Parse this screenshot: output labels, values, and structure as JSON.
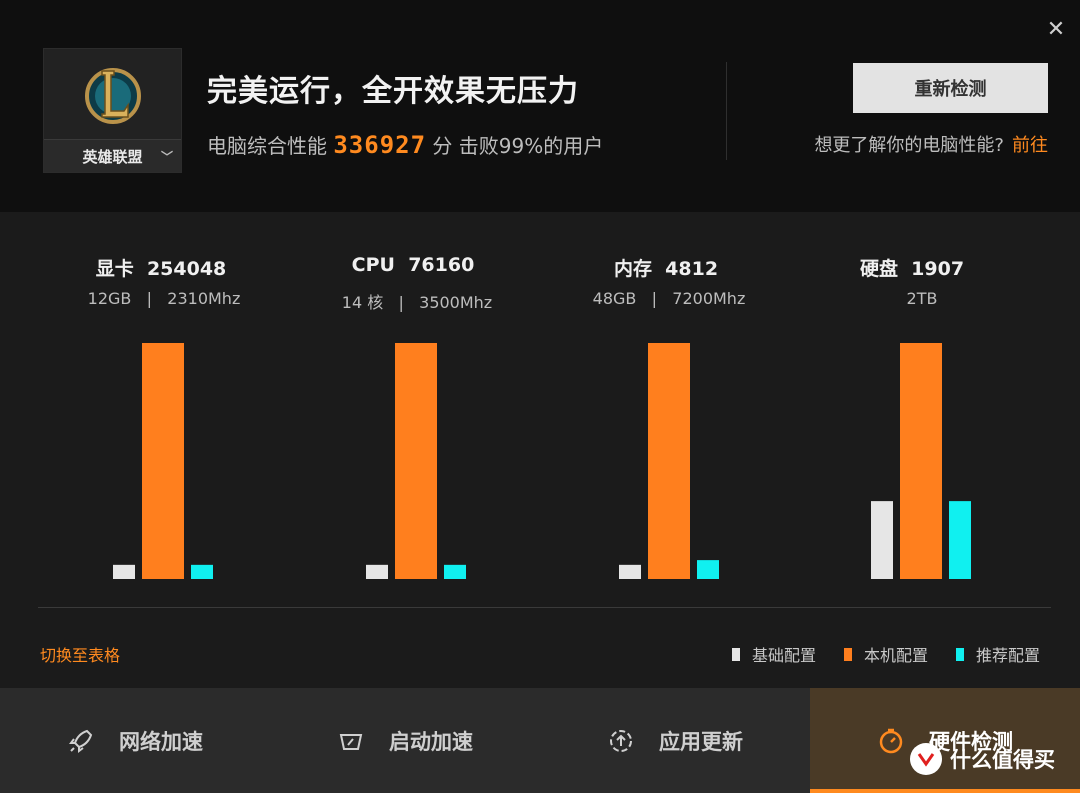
{
  "window": {
    "close_glyph": "✕"
  },
  "game": {
    "name": "英雄联盟",
    "logo_letter": "L"
  },
  "header": {
    "headline": "完美运行，全开效果无压力",
    "score_prefix": "电脑综合性能",
    "score_value": "336927",
    "score_suffix": "分 击败99%的用户",
    "recheck_label": "重新检测",
    "learn_text": "想更了解你的电脑性能?",
    "learn_link": "前往"
  },
  "colors": {
    "accent": "#ff8a1f",
    "baseline_bar": "#e6e6e6",
    "machine_bar": "#ff7f1e",
    "recommend_bar": "#10f0f0"
  },
  "chart_data": {
    "type": "bar",
    "categories": [
      "显卡",
      "CPU",
      "内存",
      "硬盘"
    ],
    "category_titles": [
      "显卡  254048",
      "CPU  76160",
      "内存  4812",
      "硬盘  1907"
    ],
    "category_specs": [
      "12GB   |   2310Mhz",
      "14 核   |   3500Mhz",
      "48GB   |   7200Mhz",
      "2TB"
    ],
    "series": [
      {
        "name": "基础配置",
        "values": [
          0.06,
          0.06,
          0.06,
          0.33
        ]
      },
      {
        "name": "本机配置",
        "values": [
          1.0,
          1.0,
          1.0,
          1.0
        ]
      },
      {
        "name": "推荐配置",
        "values": [
          0.06,
          0.06,
          0.08,
          0.33
        ]
      }
    ],
    "ylim": [
      0,
      1
    ]
  },
  "chart_ui": {
    "switch_label": "切换至表格",
    "legend": [
      "基础配置",
      "本机配置",
      "推荐配置"
    ]
  },
  "nav": {
    "items": [
      {
        "label": "网络加速",
        "icon": "rocket-icon"
      },
      {
        "label": "启动加速",
        "icon": "speedometer-icon"
      },
      {
        "label": "应用更新",
        "icon": "update-icon"
      },
      {
        "label": "硬件检测",
        "icon": "timer-icon"
      }
    ]
  },
  "watermark": {
    "text": "什么值得买",
    "badge": "值"
  }
}
